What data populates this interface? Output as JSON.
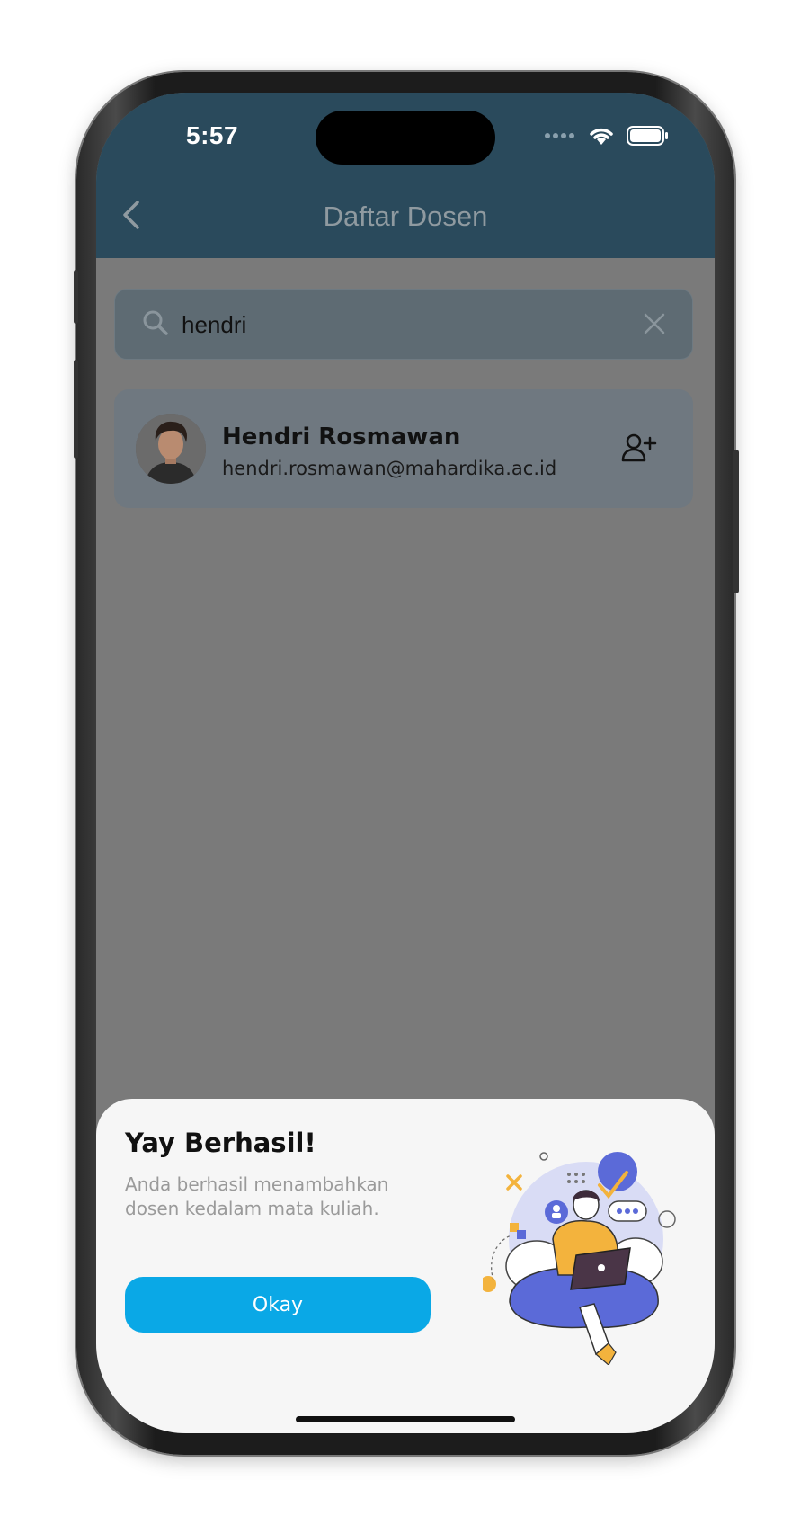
{
  "status_bar": {
    "time": "5:57"
  },
  "app_bar": {
    "title": "Daftar Dosen"
  },
  "search": {
    "value": "hendri"
  },
  "lecturers": [
    {
      "name": "Hendri Rosmawan",
      "email": "hendri.rosmawan@mahardika.ac.id"
    }
  ],
  "dialog": {
    "title": "Yay Berhasil!",
    "message": "Anda berhasil menambahkan dosen kedalam mata kuliah.",
    "button_label": "Okay"
  },
  "colors": {
    "app_bar": "#2a4a5c",
    "overlay": "#7a7a7a",
    "primary_button": "#0aa8e6",
    "illustration_accent": "#5b6ad8",
    "illustration_secondary": "#f3b33d"
  },
  "icons": [
    "back-icon",
    "search-icon",
    "clear-icon",
    "add-user-icon",
    "wifi-icon",
    "battery-icon",
    "signal-icon"
  ]
}
